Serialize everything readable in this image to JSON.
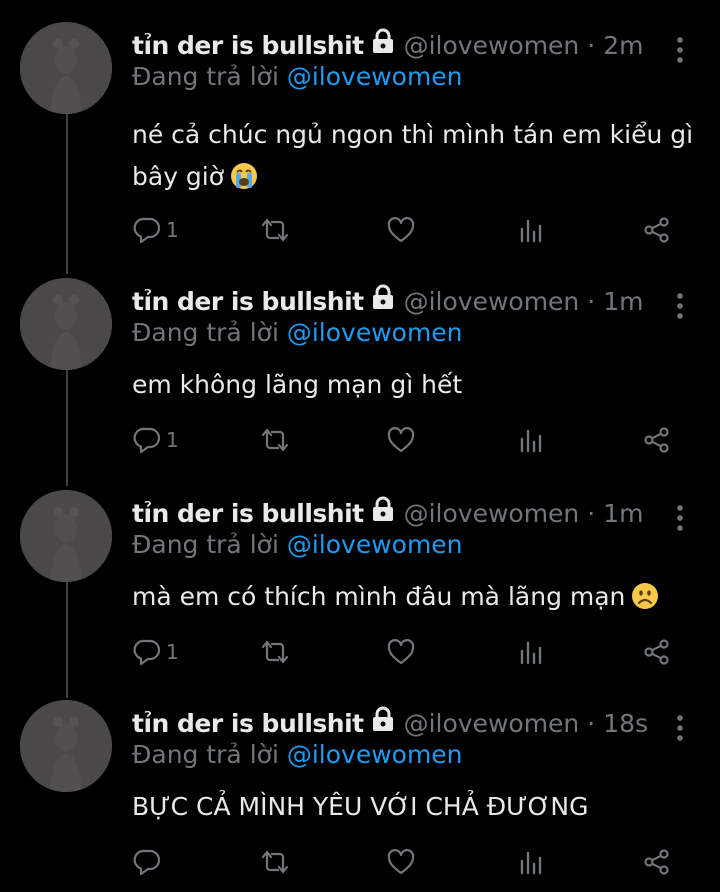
{
  "tweets": [
    {
      "name": "tỉn der is bullshit",
      "handle": "@ilovewomen",
      "separator": "·",
      "time": "2m",
      "reply_prefix": "Đang trả lời",
      "reply_to": "@ilovewomen",
      "lines": [
        "né cả chúc ngủ ngon thì mình tán em kiểu gì",
        "bây giờ"
      ],
      "emoji": "loudly-crying-face",
      "reply_count": "1"
    },
    {
      "name": "tỉn der is bullshit",
      "handle": "@ilovewomen",
      "separator": "·",
      "time": "1m",
      "reply_prefix": "Đang trả lời",
      "reply_to": "@ilovewomen",
      "lines": [
        "em không lãng mạn gì hết"
      ],
      "emoji": "",
      "reply_count": "1"
    },
    {
      "name": "tỉn der is bullshit",
      "handle": "@ilovewomen",
      "separator": "·",
      "time": "1m",
      "reply_prefix": "Đang trả lời",
      "reply_to": "@ilovewomen",
      "lines": [
        "mà em có thích mình đâu mà lãng mạn"
      ],
      "emoji": "frowning-face",
      "reply_count": "1"
    },
    {
      "name": "tỉn der is bullshit",
      "handle": "@ilovewomen",
      "separator": "·",
      "time": "18s",
      "reply_prefix": "Đang trả lời",
      "reply_to": "@ilovewomen",
      "lines": [
        "BỰC CẢ MÌNH YÊU VỚI CHẢ ĐƯƠNG"
      ],
      "emoji": "",
      "reply_count": ""
    }
  ],
  "icons": {
    "lock": "lock-icon",
    "more": "more-vertical-icon",
    "reply": "reply-icon",
    "retweet": "retweet-icon",
    "like": "heart-icon",
    "analytics": "analytics-icon",
    "share": "share-icon"
  },
  "colors": {
    "background": "#000000",
    "text": "#e7e9ea",
    "muted": "#71767b",
    "link": "#1d9bf0",
    "thread_line": "#3d4247"
  }
}
